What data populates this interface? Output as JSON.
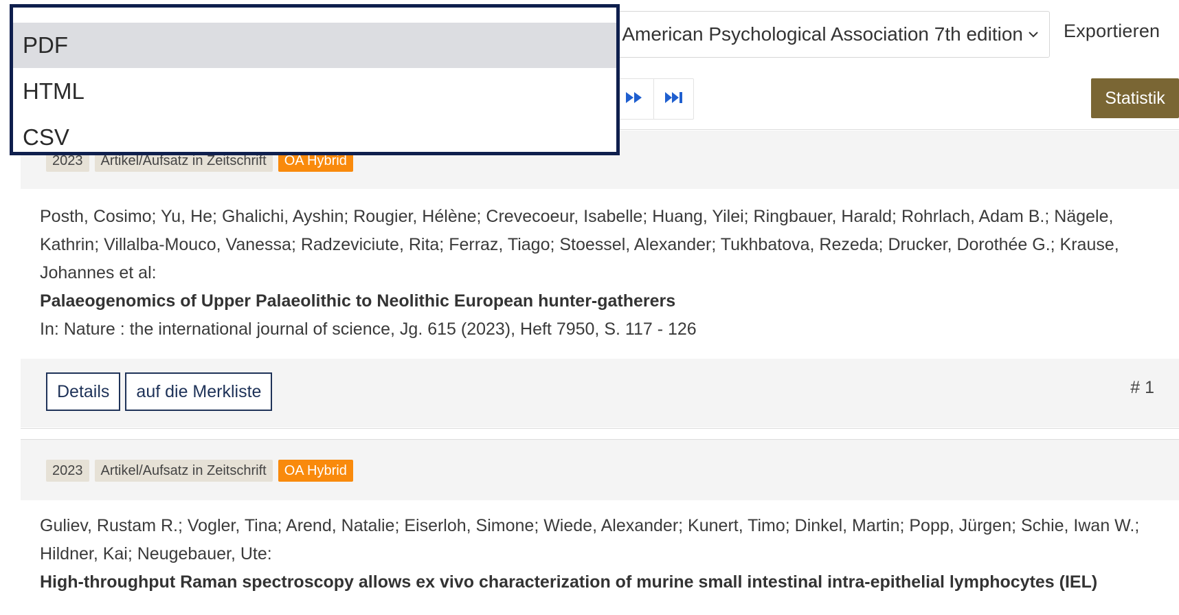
{
  "toolbar": {
    "citation_style": "American Psychological Association 7th edition",
    "export_label": "Exportieren",
    "statistics_label": "Statistik"
  },
  "export_menu": {
    "options": [
      {
        "label": "PDF",
        "selected": true
      },
      {
        "label": "HTML",
        "selected": false
      },
      {
        "label": "CSV",
        "selected": false
      }
    ]
  },
  "results": [
    {
      "year": "2023",
      "type": "Artikel/Aufsatz in Zeitschrift",
      "access": "OA Hybrid",
      "authors": "Posth, Cosimo; Yu, He; Ghalichi, Ayshin; Rougier, Hélène; Crevecoeur, Isabelle; Huang, Yilei; Ringbauer, Harald; Rohrlach, Adam B.; Nägele, Kathrin; Villalba-Mouco, Vanessa; Radzeviciute, Rita; Ferraz, Tiago; Stoessel, Alexander; Tukhbatova, Rezeda; Drucker, Dorothée G.; Krause, Johannes et al:",
      "title": "Palaeogenomics of Upper Palaeolithic to Neolithic European hunter-gatherers",
      "source": "In: Nature : the international journal of science, Jg. 615 (2023), Heft 7950, S. 117 - 126",
      "details_label": "Details",
      "watchlist_label": "auf die Merkliste",
      "hit_number": "# 1"
    },
    {
      "year": "2023",
      "type": "Artikel/Aufsatz in Zeitschrift",
      "access": "OA Hybrid",
      "authors": "Guliev, Rustam R.; Vogler, Tina; Arend, Natalie; Eiserloh, Simone; Wiede, Alexander; Kunert, Timo; Dinkel, Martin; Popp, Jürgen; Schie, Iwan W.; Hildner, Kai; Neugebauer, Ute:",
      "title": "High-throughput Raman spectroscopy allows ex vivo characterization of murine small intestinal intra-epithelial lymphocytes (IEL)"
    }
  ],
  "colors": {
    "accent_navy": "#1e3258",
    "statistik_bg": "#7a6634",
    "oa_badge": "#f98a0c",
    "pager_icon": "#1f5fcf"
  }
}
